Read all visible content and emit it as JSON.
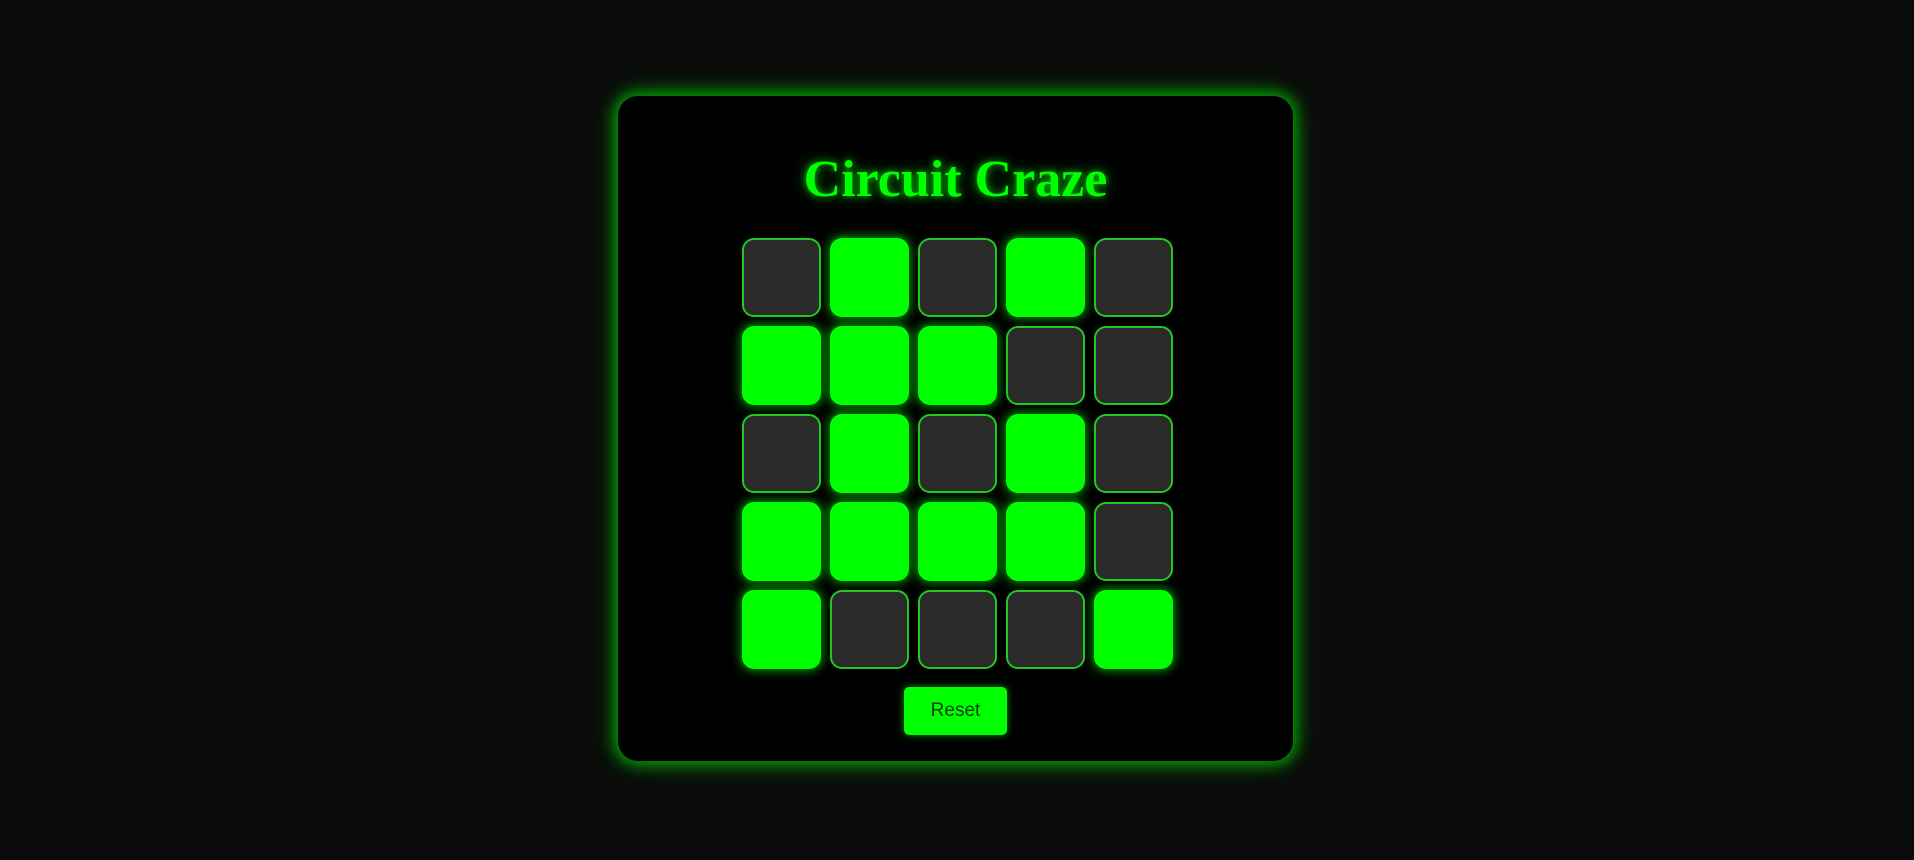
{
  "game": {
    "title": "Circuit Craze",
    "reset_label": "Reset",
    "grid_size": 5,
    "board": [
      [
        false,
        true,
        false,
        true,
        false
      ],
      [
        true,
        true,
        true,
        false,
        false
      ],
      [
        false,
        true,
        false,
        true,
        false
      ],
      [
        true,
        true,
        true,
        true,
        false
      ],
      [
        true,
        false,
        false,
        false,
        true
      ]
    ]
  },
  "colors": {
    "background": "#0a0a0a",
    "panel": "#000000",
    "accent": "#00ff00",
    "cell_off": "#2b2b2b",
    "cell_off_border": "#22c722",
    "button_text": "#0b3d0b"
  }
}
